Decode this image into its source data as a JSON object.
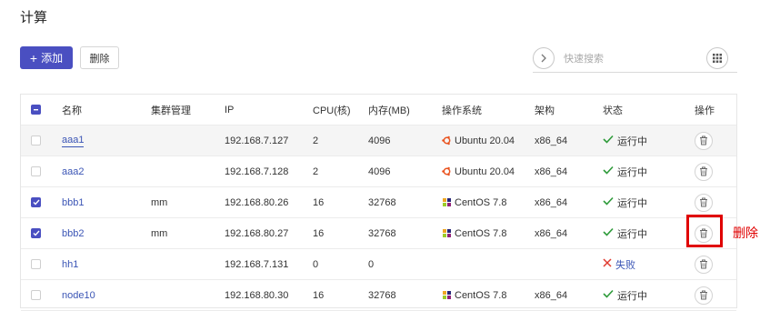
{
  "page": {
    "title": "计算"
  },
  "toolbar": {
    "add_label": "添加",
    "delete_label": "删除"
  },
  "search": {
    "placeholder": "快速搜索",
    "value": ""
  },
  "table": {
    "columns": [
      "名称",
      "集群管理",
      "IP",
      "CPU(核)",
      "内存(MB)",
      "操作系统",
      "架构",
      "状态",
      "操作"
    ],
    "rows": [
      {
        "checked": false,
        "name": "aaa1",
        "cluster": "",
        "ip": "192.168.7.127",
        "cpu": "2",
        "mem": "4096",
        "os": "Ubuntu 20.04",
        "os_icon": "ubuntu-icon",
        "arch": "x86_64",
        "status": "运行中",
        "status_type": "ok"
      },
      {
        "checked": false,
        "name": "aaa2",
        "cluster": "",
        "ip": "192.168.7.128",
        "cpu": "2",
        "mem": "4096",
        "os": "Ubuntu 20.04",
        "os_icon": "ubuntu-icon",
        "arch": "x86_64",
        "status": "运行中",
        "status_type": "ok"
      },
      {
        "checked": true,
        "name": "bbb1",
        "cluster": "mm",
        "ip": "192.168.80.26",
        "cpu": "16",
        "mem": "32768",
        "os": "CentOS 7.8",
        "os_icon": "centos-icon",
        "arch": "x86_64",
        "status": "运行中",
        "status_type": "ok"
      },
      {
        "checked": true,
        "name": "bbb2",
        "cluster": "mm",
        "ip": "192.168.80.27",
        "cpu": "16",
        "mem": "32768",
        "os": "CentOS 7.8",
        "os_icon": "centos-icon",
        "arch": "x86_64",
        "status": "运行中",
        "status_type": "ok"
      },
      {
        "checked": false,
        "name": "hh1",
        "cluster": "",
        "ip": "192.168.7.131",
        "cpu": "0",
        "mem": "0",
        "os": "",
        "os_icon": "",
        "arch": "",
        "status": "失败",
        "status_type": "fail"
      },
      {
        "checked": false,
        "name": "node10",
        "cluster": "",
        "ip": "192.168.80.30",
        "cpu": "16",
        "mem": "32768",
        "os": "CentOS 7.8",
        "os_icon": "centos-icon",
        "arch": "x86_64",
        "status": "运行中",
        "status_type": "ok"
      }
    ]
  },
  "annotation": {
    "label": "删除"
  },
  "colors": {
    "primary": "#4a4fc1",
    "link": "#3b55b5",
    "ok": "#2e9b3a",
    "fail": "#e03a2f",
    "ubuntu": "#e95420",
    "highlight": "#e00000"
  }
}
